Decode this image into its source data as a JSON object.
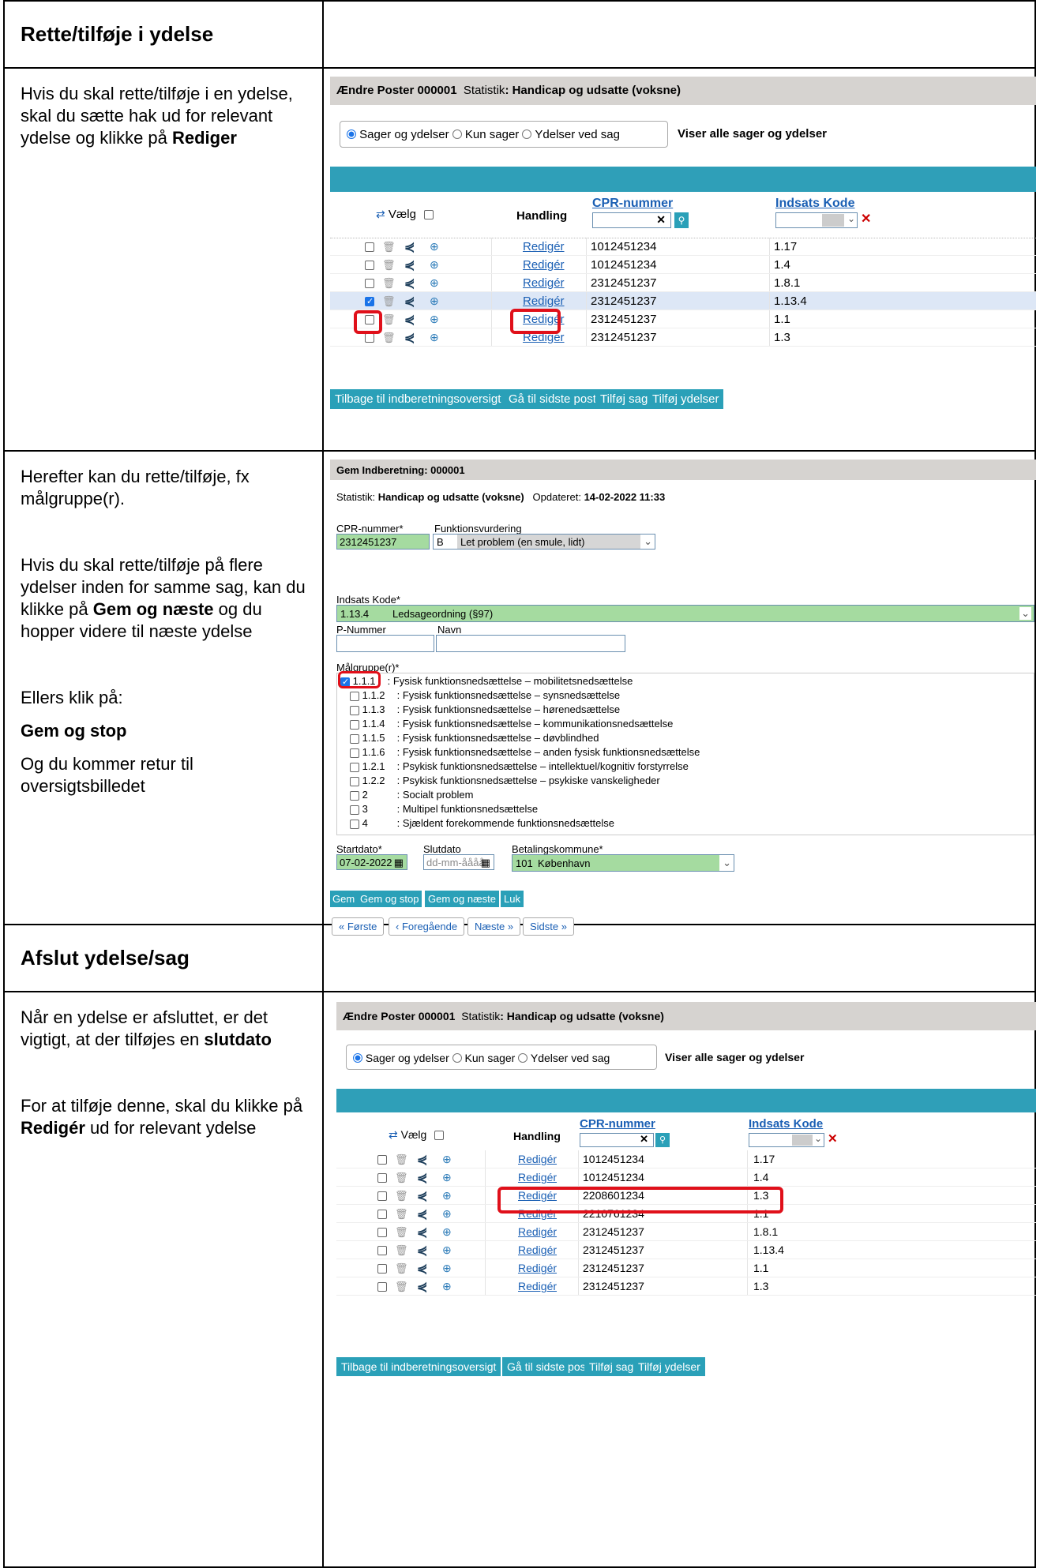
{
  "sections": {
    "rette_title": "Rette/tilføje i ydelse",
    "afslut_title": "Afslut ydelse/sag"
  },
  "instructions": {
    "r1_a": "Hvis du skal rette/tilføje i en ydelse, skal du sætte hak ud for relevant ydelse og klikke på ",
    "r1_b": "Rediger",
    "r2_a": "Herefter kan du rette/tilføje, fx målgruppe(r).",
    "r2_b1": "Hvis du skal rette/tilføje på flere ydelser inden for samme sag, kan du klikke på ",
    "r2_b2": "Gem og næste",
    "r2_b3": " og du hopper videre til næste ydelse",
    "r2_c": "Ellers klik på:",
    "r2_d": "Gem og stop",
    "r2_e": "Og du kommer retur til oversigtsbilledet",
    "r3_a1": "Når en ydelse er afsluttet, er det vigtigt, at der tilføjes en ",
    "r3_a2": "slutdato",
    "r3_b1": "For at tilføje denne, skal du klikke på ",
    "r3_b2": "Redigér",
    "r3_b3": " ud for relevant ydelse"
  },
  "overview": {
    "title_bold": "Ændre Poster 000001",
    "title_stat": "Statistik",
    "title_rest": ": Handicap og udsatte (voksne)",
    "radio1": "Sager og ydelser",
    "radio2": "Kun sager",
    "radio3": "Ydelser ved sag",
    "view_note": "Viser alle sager og ydelser",
    "col_select": "Vælg",
    "col_action": "Handling",
    "col_cpr": "CPR-nummer",
    "col_code": "Indsats Kode",
    "edit_label": "Redigér",
    "btn_back": "Tilbage til indberetningsoversigt",
    "btn_last": "Gå til sidste post",
    "btn_add_case": "Tilføj sag",
    "btn_add_benefit": "Tilføj ydelser",
    "rows1": [
      {
        "cpr": "1012451234",
        "code": "1.17"
      },
      {
        "cpr": "1012451234",
        "code": "1.4"
      },
      {
        "cpr": "2312451237",
        "code": "1.8.1"
      },
      {
        "cpr": "2312451237",
        "code": "1.13.4"
      },
      {
        "cpr": "2312451237",
        "code": "1.1"
      },
      {
        "cpr": "2312451237",
        "code": "1.3"
      }
    ],
    "rows2": [
      {
        "cpr": "1012451234",
        "code": "1.17"
      },
      {
        "cpr": "1012451234",
        "code": "1.4"
      },
      {
        "cpr": "2208601234",
        "code": "1.3"
      },
      {
        "cpr": "2210761234",
        "code": "1.1"
      },
      {
        "cpr": "2312451237",
        "code": "1.8.1"
      },
      {
        "cpr": "2312451237",
        "code": "1.13.4"
      },
      {
        "cpr": "2312451237",
        "code": "1.1"
      },
      {
        "cpr": "2312451237",
        "code": "1.3"
      }
    ]
  },
  "form": {
    "title": "Gem Indberetning: 000001",
    "stat_label": "Statistik: ",
    "stat_value": "Handicap og udsatte (voksne)",
    "updated_label": "Opdateret: ",
    "updated_value": "14-02-2022 11:33",
    "cpr_label": "CPR-nummer*",
    "cpr_value": "2312451237",
    "funk_label": "Funktionsvurdering",
    "funk_code": "B",
    "funk_text": "Let problem (en smule, lidt)",
    "code_label": "Indsats Kode*",
    "code_value": "1.13.4",
    "code_text": "Ledsageordning (§97)",
    "pnum_label": "P-Nummer",
    "navn_label": "Navn",
    "malgruppe_label": "Målgruppe(r)*",
    "malgrupper": [
      {
        "code": "1.1.1",
        "text": ": Fysisk funktionsnedsættelse – mobilitetsnedsættelse"
      },
      {
        "code": "1.1.2",
        "text": ": Fysisk funktionsnedsættelse – synsnedsættelse"
      },
      {
        "code": "1.1.3",
        "text": ": Fysisk funktionsnedsættelse – hørenedsættelse"
      },
      {
        "code": "1.1.4",
        "text": ": Fysisk funktionsnedsættelse – kommunikationsnedsættelse"
      },
      {
        "code": "1.1.5",
        "text": ": Fysisk funktionsnedsættelse – døvblindhed"
      },
      {
        "code": "1.1.6",
        "text": ": Fysisk funktionsnedsættelse – anden fysisk funktionsnedsættelse"
      },
      {
        "code": "1.2.1",
        "text": ": Psykisk funktionsnedsættelse – intellektuel/kognitiv forstyrrelse"
      },
      {
        "code": "1.2.2",
        "text": ": Psykisk funktionsnedsættelse – psykiske vanskeligheder"
      },
      {
        "code": "2",
        "text": ": Socialt problem"
      },
      {
        "code": "3",
        "text": ": Multipel funktionsnedsættelse"
      },
      {
        "code": "4",
        "text": ": Sjældent forekommende funktionsnedsættelse"
      }
    ],
    "start_label": "Startdato*",
    "start_value": "07-02-2022",
    "slut_label": "Slutdato",
    "slut_placeholder": "dd-mm-åååå",
    "kommune_label": "Betalingskommune*",
    "kommune_code": "101",
    "kommune_name": "København",
    "btn_gem": "Gem",
    "btn_gem_stop": "Gem og stop",
    "btn_gem_naeste": "Gem og næste",
    "btn_luk": "Luk",
    "nav_first": "« Første",
    "nav_prev": "‹ Foregående",
    "nav_next": "Næste »",
    "nav_last": "Sidste »"
  }
}
